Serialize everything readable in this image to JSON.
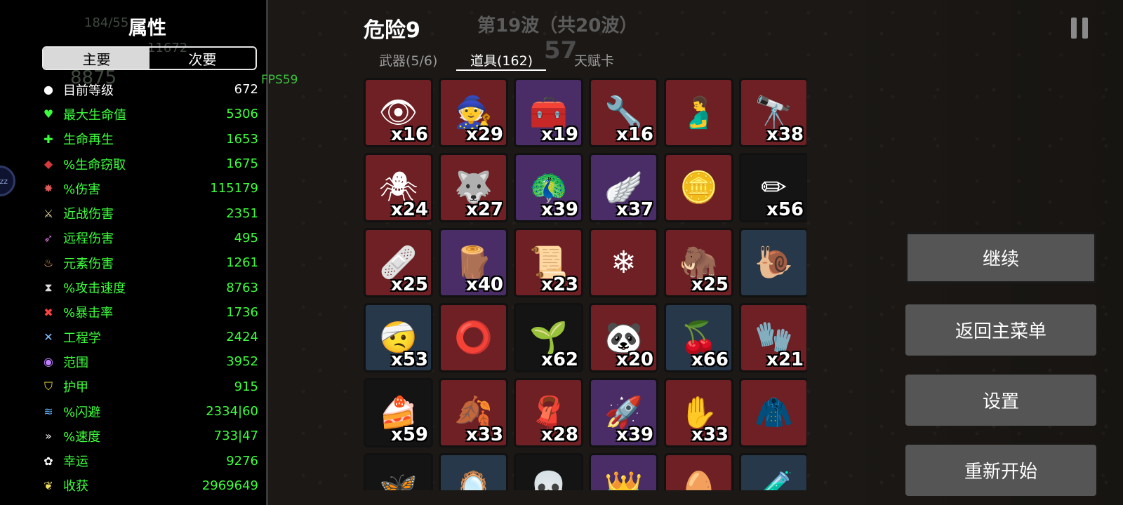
{
  "left_panel": {
    "title": "属性",
    "ghost_text_1": "184/55",
    "ghost_text_2": "11672",
    "ghost_text_3": "8875",
    "tabs": [
      "主要",
      "次要"
    ],
    "active_tab": "主要",
    "stats": [
      {
        "icon": "level-icon",
        "glyph": "●",
        "color": "#ffffff",
        "label": "目前等级",
        "value": "672",
        "white": true
      },
      {
        "icon": "heart-icon",
        "glyph": "♥",
        "color": "#3cff3c",
        "label": "最大生命值",
        "value": "5306"
      },
      {
        "icon": "regen-icon",
        "glyph": "✚",
        "color": "#3cff3c",
        "label": "生命再生",
        "value": "1653"
      },
      {
        "icon": "lifesteal-icon",
        "glyph": "◆",
        "color": "#d63a3a",
        "label": "%生命窃取",
        "value": "1675"
      },
      {
        "icon": "damage-icon",
        "glyph": "✸",
        "color": "#e05a5a",
        "label": "%伤害",
        "value": "115179"
      },
      {
        "icon": "melee-icon",
        "glyph": "⚔",
        "color": "#e8d6a0",
        "label": "近战伤害",
        "value": "2351"
      },
      {
        "icon": "ranged-icon",
        "glyph": "➶",
        "color": "#d070d0",
        "label": "远程伤害",
        "value": "495"
      },
      {
        "icon": "elemental-icon",
        "glyph": "♨",
        "color": "#f0a050",
        "label": "元素伤害",
        "value": "1261"
      },
      {
        "icon": "attack-speed-icon",
        "glyph": "⧗",
        "color": "#dddddd",
        "label": "%攻击速度",
        "value": "8763"
      },
      {
        "icon": "crit-icon",
        "glyph": "✖",
        "color": "#ff4040",
        "label": "%暴击率",
        "value": "1736"
      },
      {
        "icon": "engineering-icon",
        "glyph": "✕",
        "color": "#80c0ff",
        "label": "工程学",
        "value": "2424"
      },
      {
        "icon": "range-icon",
        "glyph": "◉",
        "color": "#c080ff",
        "label": "范围",
        "value": "3952"
      },
      {
        "icon": "armor-icon",
        "glyph": "⛉",
        "color": "#f0e040",
        "label": "护甲",
        "value": "915"
      },
      {
        "icon": "dodge-icon",
        "glyph": "≋",
        "color": "#60b0ff",
        "label": "%闪避",
        "value": "2334|60"
      },
      {
        "icon": "speed-icon",
        "glyph": "»",
        "color": "#ffffff",
        "label": "%速度",
        "value": "733|47"
      },
      {
        "icon": "luck-icon",
        "glyph": "✿",
        "color": "#ffffff",
        "label": "幸运",
        "value": "9276"
      },
      {
        "icon": "harvest-icon",
        "glyph": "❦",
        "color": "#f0e060",
        "label": "收获",
        "value": "2969649"
      }
    ],
    "side_bubble": "zz"
  },
  "fps": "FPS59",
  "header": {
    "danger": "危险9",
    "wave": "第19波（共20波）",
    "wave_timer": "57",
    "tabs": [
      "武器(5/6)",
      "道具(162)",
      "天赋卡"
    ],
    "active_tab": "道具(162)"
  },
  "items": [
    {
      "name": "sprout-eye-item",
      "bg": "red",
      "glyph": "👁",
      "count": "x16"
    },
    {
      "name": "gnome-item",
      "bg": "red",
      "glyph": "🧙",
      "count": "x29"
    },
    {
      "name": "toolbox-item",
      "bg": "purple",
      "glyph": "🧰",
      "count": "x19"
    },
    {
      "name": "robot-arm-item",
      "bg": "red",
      "glyph": "🔧",
      "count": "x16"
    },
    {
      "name": "stomach-item",
      "bg": "red",
      "glyph": "🫃",
      "count": ""
    },
    {
      "name": "binoculars-item",
      "bg": "red",
      "glyph": "🔭",
      "count": "x38"
    },
    {
      "name": "spider-bot-item",
      "bg": "red",
      "glyph": "🕷",
      "count": "x24"
    },
    {
      "name": "wolf-helmet-item",
      "bg": "red",
      "glyph": "🐺",
      "count": "x27"
    },
    {
      "name": "peacock-item",
      "bg": "purple",
      "glyph": "🦚",
      "count": "x39"
    },
    {
      "name": "wings-item",
      "bg": "purple",
      "glyph": "🪽",
      "count": "x37"
    },
    {
      "name": "gold-coin-item",
      "bg": "red",
      "glyph": "🪙",
      "count": ""
    },
    {
      "name": "pencil-item",
      "bg": "black",
      "glyph": "✏",
      "count": "x56"
    },
    {
      "name": "medkit-item",
      "bg": "red",
      "glyph": "🩹",
      "count": "x25"
    },
    {
      "name": "planks-item",
      "bg": "purple",
      "glyph": "🪵",
      "count": "x40"
    },
    {
      "name": "scroll-item",
      "bg": "red",
      "glyph": "📜",
      "count": "x23"
    },
    {
      "name": "snowflake-charm-item",
      "bg": "red",
      "glyph": "❄",
      "count": ""
    },
    {
      "name": "mammoth-item",
      "bg": "red",
      "glyph": "🦣",
      "count": "x25"
    },
    {
      "name": "snail-item",
      "bg": "blue",
      "glyph": "🐌",
      "count": ""
    },
    {
      "name": "hurt-ball-item",
      "bg": "blue",
      "glyph": "🤕",
      "count": "x53"
    },
    {
      "name": "collar-item",
      "bg": "red",
      "glyph": "⭕",
      "count": ""
    },
    {
      "name": "sprout-item",
      "bg": "black",
      "glyph": "🌱",
      "count": "x62"
    },
    {
      "name": "panda-item",
      "bg": "red",
      "glyph": "🐼",
      "count": "x20"
    },
    {
      "name": "cherry-knife-item",
      "bg": "blue",
      "glyph": "🍒",
      "count": "x66"
    },
    {
      "name": "glove-item",
      "bg": "red",
      "glyph": "🧤",
      "count": "x21"
    },
    {
      "name": "cake-item",
      "bg": "black",
      "glyph": "🍰",
      "count": "x59"
    },
    {
      "name": "rainbow-leaf-item",
      "bg": "red",
      "glyph": "🍂",
      "count": "x33"
    },
    {
      "name": "cape-item",
      "bg": "red",
      "glyph": "🧣",
      "count": "x28"
    },
    {
      "name": "rocket-item",
      "bg": "purple",
      "glyph": "🚀",
      "count": "x39"
    },
    {
      "name": "bloody-hand-item",
      "bg": "red",
      "glyph": "✋",
      "count": "x33"
    },
    {
      "name": "hoodie-item",
      "bg": "red",
      "glyph": "🧥",
      "count": ""
    },
    {
      "name": "butterfly-item",
      "bg": "black",
      "glyph": "🦋",
      "count": ""
    },
    {
      "name": "mirror-item",
      "bg": "blue",
      "glyph": "🪞",
      "count": ""
    },
    {
      "name": "mask-item",
      "bg": "black",
      "glyph": "💀",
      "count": ""
    },
    {
      "name": "crown-item",
      "bg": "purple",
      "glyph": "👑",
      "count": ""
    },
    {
      "name": "egg-item",
      "bg": "red",
      "glyph": "🥚",
      "count": ""
    },
    {
      "name": "potion-item",
      "bg": "blue",
      "glyph": "🧪",
      "count": ""
    }
  ],
  "menu": {
    "continue": "继续",
    "main_menu": "返回主菜单",
    "settings": "设置",
    "restart": "重新开始"
  }
}
